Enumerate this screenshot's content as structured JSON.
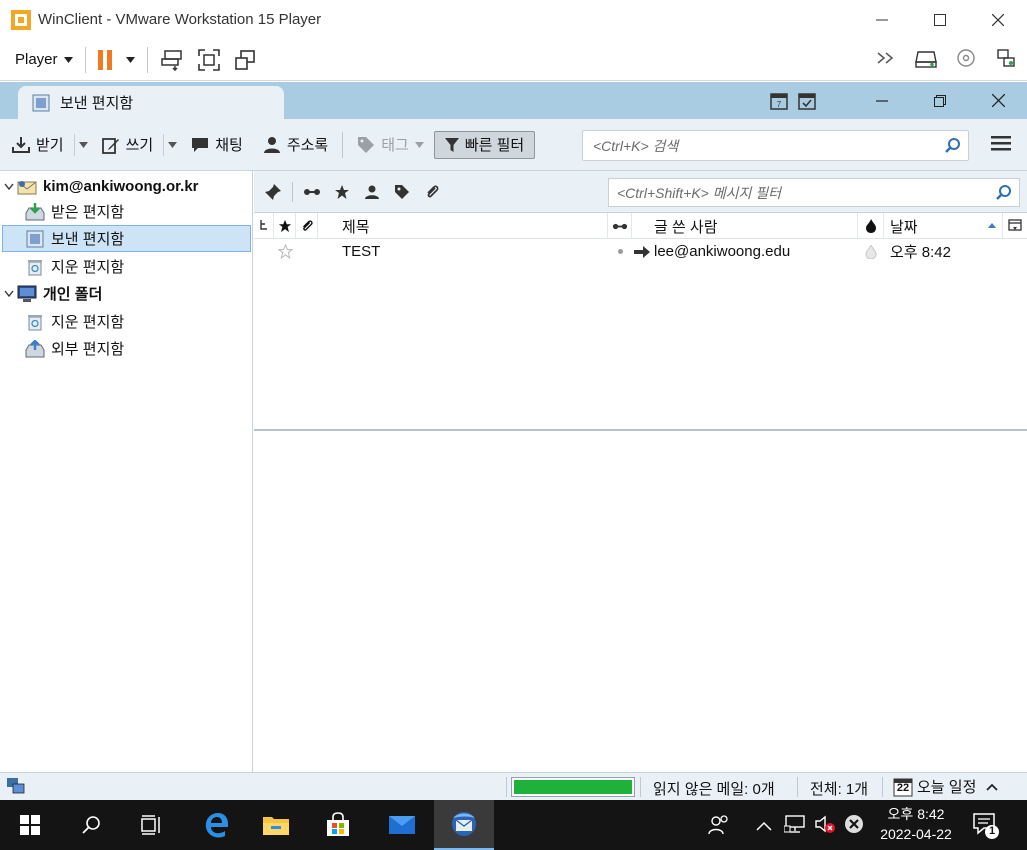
{
  "vm": {
    "title": "WinClient - VMware Workstation 15 Player",
    "player_label": "Player",
    "colors": {
      "pause": "#f07a22"
    }
  },
  "tb": {
    "tab_label": "보낸 편지함",
    "toolbar": {
      "get_label": "받기",
      "write_label": "쓰기",
      "chat_label": "채팅",
      "address_label": "주소록",
      "tag_label": "태그",
      "quickfilter_label": "빠른 필터"
    },
    "search_placeholder": "<Ctrl+K> 검색",
    "folders": [
      {
        "label": "kim@ankiwoong.or.kr",
        "icon": "account-icon"
      },
      {
        "label": "받은 편지함",
        "icon": "inbox-icon"
      },
      {
        "label": "보낸 편지함",
        "icon": "sent-icon"
      },
      {
        "label": "지운 편지함",
        "icon": "trash-icon"
      },
      {
        "label": "개인 폴더",
        "icon": "local-folders-icon"
      },
      {
        "label": "지운 편지함",
        "icon": "trash-icon"
      },
      {
        "label": "외부 편지함",
        "icon": "outbox-icon"
      }
    ],
    "filter_placeholder": "<Ctrl+Shift+K> 메시지 필터",
    "columns": {
      "subject": "제목",
      "author": "글 쓴 사람",
      "date": "날짜"
    },
    "messages": [
      {
        "subject": "TEST",
        "recipient": "lee@ankiwoong.edu",
        "date": "오후 8:42"
      }
    ],
    "status": {
      "unread": "읽지 않은 메일: 0개",
      "total": "전체: 1개",
      "today": "오늘 일정",
      "calendar_day": "22",
      "progress": 1.0
    }
  },
  "taskbar": {
    "time": "오후 8:42",
    "date": "2022-04-22",
    "notification_count": "1"
  }
}
